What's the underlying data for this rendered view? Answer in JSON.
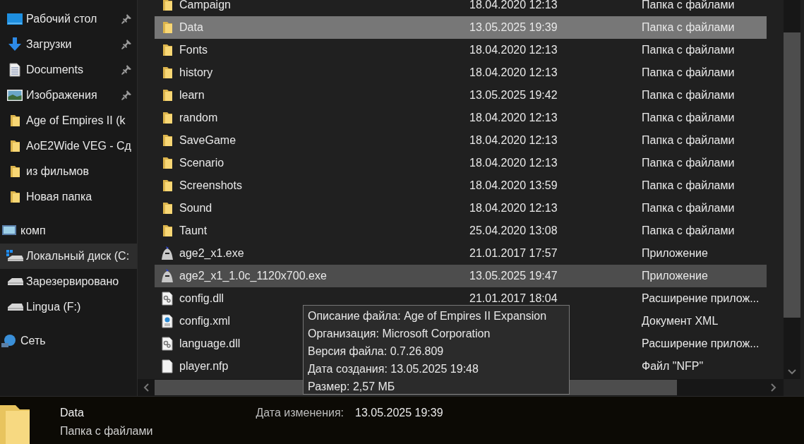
{
  "sidebar": {
    "items": [
      {
        "kind": "desktop",
        "label": "Рабочий стол",
        "pinned": true,
        "selected": false
      },
      {
        "kind": "download",
        "label": "Загрузки",
        "pinned": true,
        "selected": false
      },
      {
        "kind": "documents",
        "label": "Documents",
        "pinned": true,
        "selected": false
      },
      {
        "kind": "pictures",
        "label": "Изображения",
        "pinned": true,
        "selected": false
      },
      {
        "kind": "folder",
        "label": "Age of Empires II (k",
        "pinned": false,
        "selected": false
      },
      {
        "kind": "folder",
        "label": "AoE2Wide VEG - Сд",
        "pinned": false,
        "selected": false
      },
      {
        "kind": "folder",
        "label": "из фильмов",
        "pinned": false,
        "selected": false
      },
      {
        "kind": "folder",
        "label": "Новая папка",
        "pinned": false,
        "selected": false
      },
      {
        "kind": "pc",
        "label": "комп",
        "pinned": false,
        "selected": false
      },
      {
        "kind": "system-drive",
        "label": "Локальный диск (C:",
        "pinned": false,
        "selected": true
      },
      {
        "kind": "drive",
        "label": "Зарезервировано",
        "pinned": false,
        "selected": false
      },
      {
        "kind": "drive",
        "label": "Lingua (F:)",
        "pinned": false,
        "selected": false
      },
      {
        "kind": "network",
        "label": "Сеть",
        "pinned": false,
        "selected": false
      }
    ]
  },
  "files": [
    {
      "kind": "folder",
      "name": "Campaign",
      "date": "18.04.2020 12:13",
      "type": "Папка с файлами",
      "selected": false,
      "hovered": false
    },
    {
      "kind": "folder",
      "name": "Data",
      "date": "13.05.2025 19:39",
      "type": "Папка с файлами",
      "selected": true,
      "hovered": false
    },
    {
      "kind": "folder",
      "name": "Fonts",
      "date": "18.04.2020 12:13",
      "type": "Папка с файлами",
      "selected": false,
      "hovered": false
    },
    {
      "kind": "folder",
      "name": "history",
      "date": "18.04.2020 12:13",
      "type": "Папка с файлами",
      "selected": false,
      "hovered": false
    },
    {
      "kind": "folder",
      "name": "learn",
      "date": "13.05.2025 19:42",
      "type": "Папка с файлами",
      "selected": false,
      "hovered": false
    },
    {
      "kind": "folder",
      "name": "random",
      "date": "18.04.2020 12:13",
      "type": "Папка с файлами",
      "selected": false,
      "hovered": false
    },
    {
      "kind": "folder",
      "name": "SaveGame",
      "date": "18.04.2020 12:13",
      "type": "Папка с файлами",
      "selected": false,
      "hovered": false
    },
    {
      "kind": "folder",
      "name": "Scenario",
      "date": "18.04.2020 12:13",
      "type": "Папка с файлами",
      "selected": false,
      "hovered": false
    },
    {
      "kind": "folder",
      "name": "Screenshots",
      "date": "18.04.2020 13:59",
      "type": "Папка с файлами",
      "selected": false,
      "hovered": false
    },
    {
      "kind": "folder",
      "name": "Sound",
      "date": "18.04.2020 12:13",
      "type": "Папка с файлами",
      "selected": false,
      "hovered": false
    },
    {
      "kind": "folder",
      "name": "Taunt",
      "date": "25.04.2020 13:08",
      "type": "Папка с файлами",
      "selected": false,
      "hovered": false
    },
    {
      "kind": "exe",
      "name": "age2_x1.exe",
      "date": "21.01.2017 17:57",
      "type": "Приложение",
      "selected": false,
      "hovered": false
    },
    {
      "kind": "exe",
      "name": "age2_x1_1.0c_1120x700.exe",
      "date": "13.05.2025 19:47",
      "type": "Приложение",
      "selected": false,
      "hovered": true
    },
    {
      "kind": "dll",
      "name": "config.dll",
      "date": "21.01.2017 18:04",
      "type": "Расширение прилож...",
      "selected": false,
      "hovered": false
    },
    {
      "kind": "xml",
      "name": "config.xml",
      "type": "Документ XML",
      "selected": false,
      "hovered": false
    },
    {
      "kind": "dll",
      "name": "language.dll",
      "type": "Расширение прилож...",
      "selected": false,
      "hovered": false
    },
    {
      "kind": "file",
      "name": "player.nfp",
      "type": "Файл \"NFP\"",
      "selected": false,
      "hovered": false
    }
  ],
  "tooltip": [
    "Описание файла: Age of Empires II Expansion",
    "Организация: Microsoft Corporation",
    "Версия файла: 0.7.26.809",
    "Дата создания: 13.05.2025 19:48",
    "Размер: 2,57 МБ"
  ],
  "details": {
    "name": "Data",
    "type": "Папка с файлами",
    "date_label": "Дата изменения:",
    "date_value": "13.05.2025 19:39"
  }
}
